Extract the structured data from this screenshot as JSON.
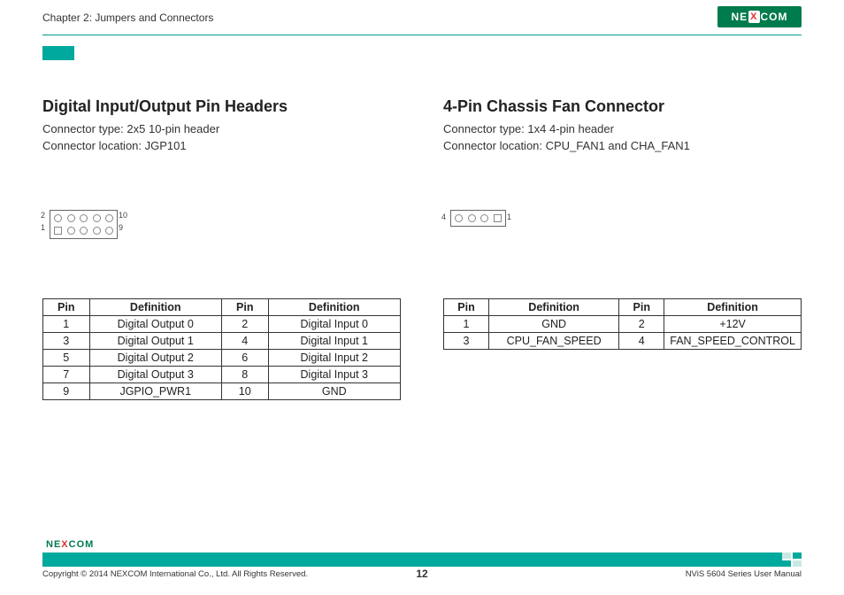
{
  "header": {
    "chapter": "Chapter 2: Jumpers and Connectors",
    "logo_text_pre": "NE",
    "logo_text_x": "X",
    "logo_text_post": "COM"
  },
  "left": {
    "title": "Digital Input/Output Pin Headers",
    "type_line": "Connector type: 2x5 10-pin header",
    "loc_line": "Connector location: JGP101",
    "diagram": {
      "label_tl": "2",
      "label_bl": "1",
      "label_tr": "10",
      "label_br": "9"
    },
    "table": {
      "headers": [
        "Pin",
        "Definition",
        "Pin",
        "Definition"
      ],
      "rows": [
        [
          "1",
          "Digital Output 0",
          "2",
          "Digital Input 0"
        ],
        [
          "3",
          "Digital Output 1",
          "4",
          "Digital Input 1"
        ],
        [
          "5",
          "Digital Output 2",
          "6",
          "Digital Input 2"
        ],
        [
          "7",
          "Digital Output 3",
          "8",
          "Digital Input 3"
        ],
        [
          "9",
          "JGPIO_PWR1",
          "10",
          "GND"
        ]
      ]
    }
  },
  "right": {
    "title": "4-Pin Chassis Fan Connector",
    "type_line": "Connector type: 1x4 4-pin header",
    "loc_line": "Connector location: CPU_FAN1 and CHA_FAN1",
    "diagram": {
      "label_l": "4",
      "label_r": "1"
    },
    "table": {
      "headers": [
        "Pin",
        "Definition",
        "Pin",
        "Definition"
      ],
      "rows": [
        [
          "1",
          "GND",
          "2",
          "+12V"
        ],
        [
          "3",
          "CPU_FAN_SPEED",
          "4",
          "FAN_SPEED_CONTROL"
        ]
      ]
    }
  },
  "footer": {
    "copyright": "Copyright © 2014 NEXCOM International Co., Ltd. All Rights Reserved.",
    "page": "12",
    "manual": "NViS 5604 Series User Manual",
    "logo_text_pre": "NE",
    "logo_text_x": "X",
    "logo_text_post": "COM"
  }
}
